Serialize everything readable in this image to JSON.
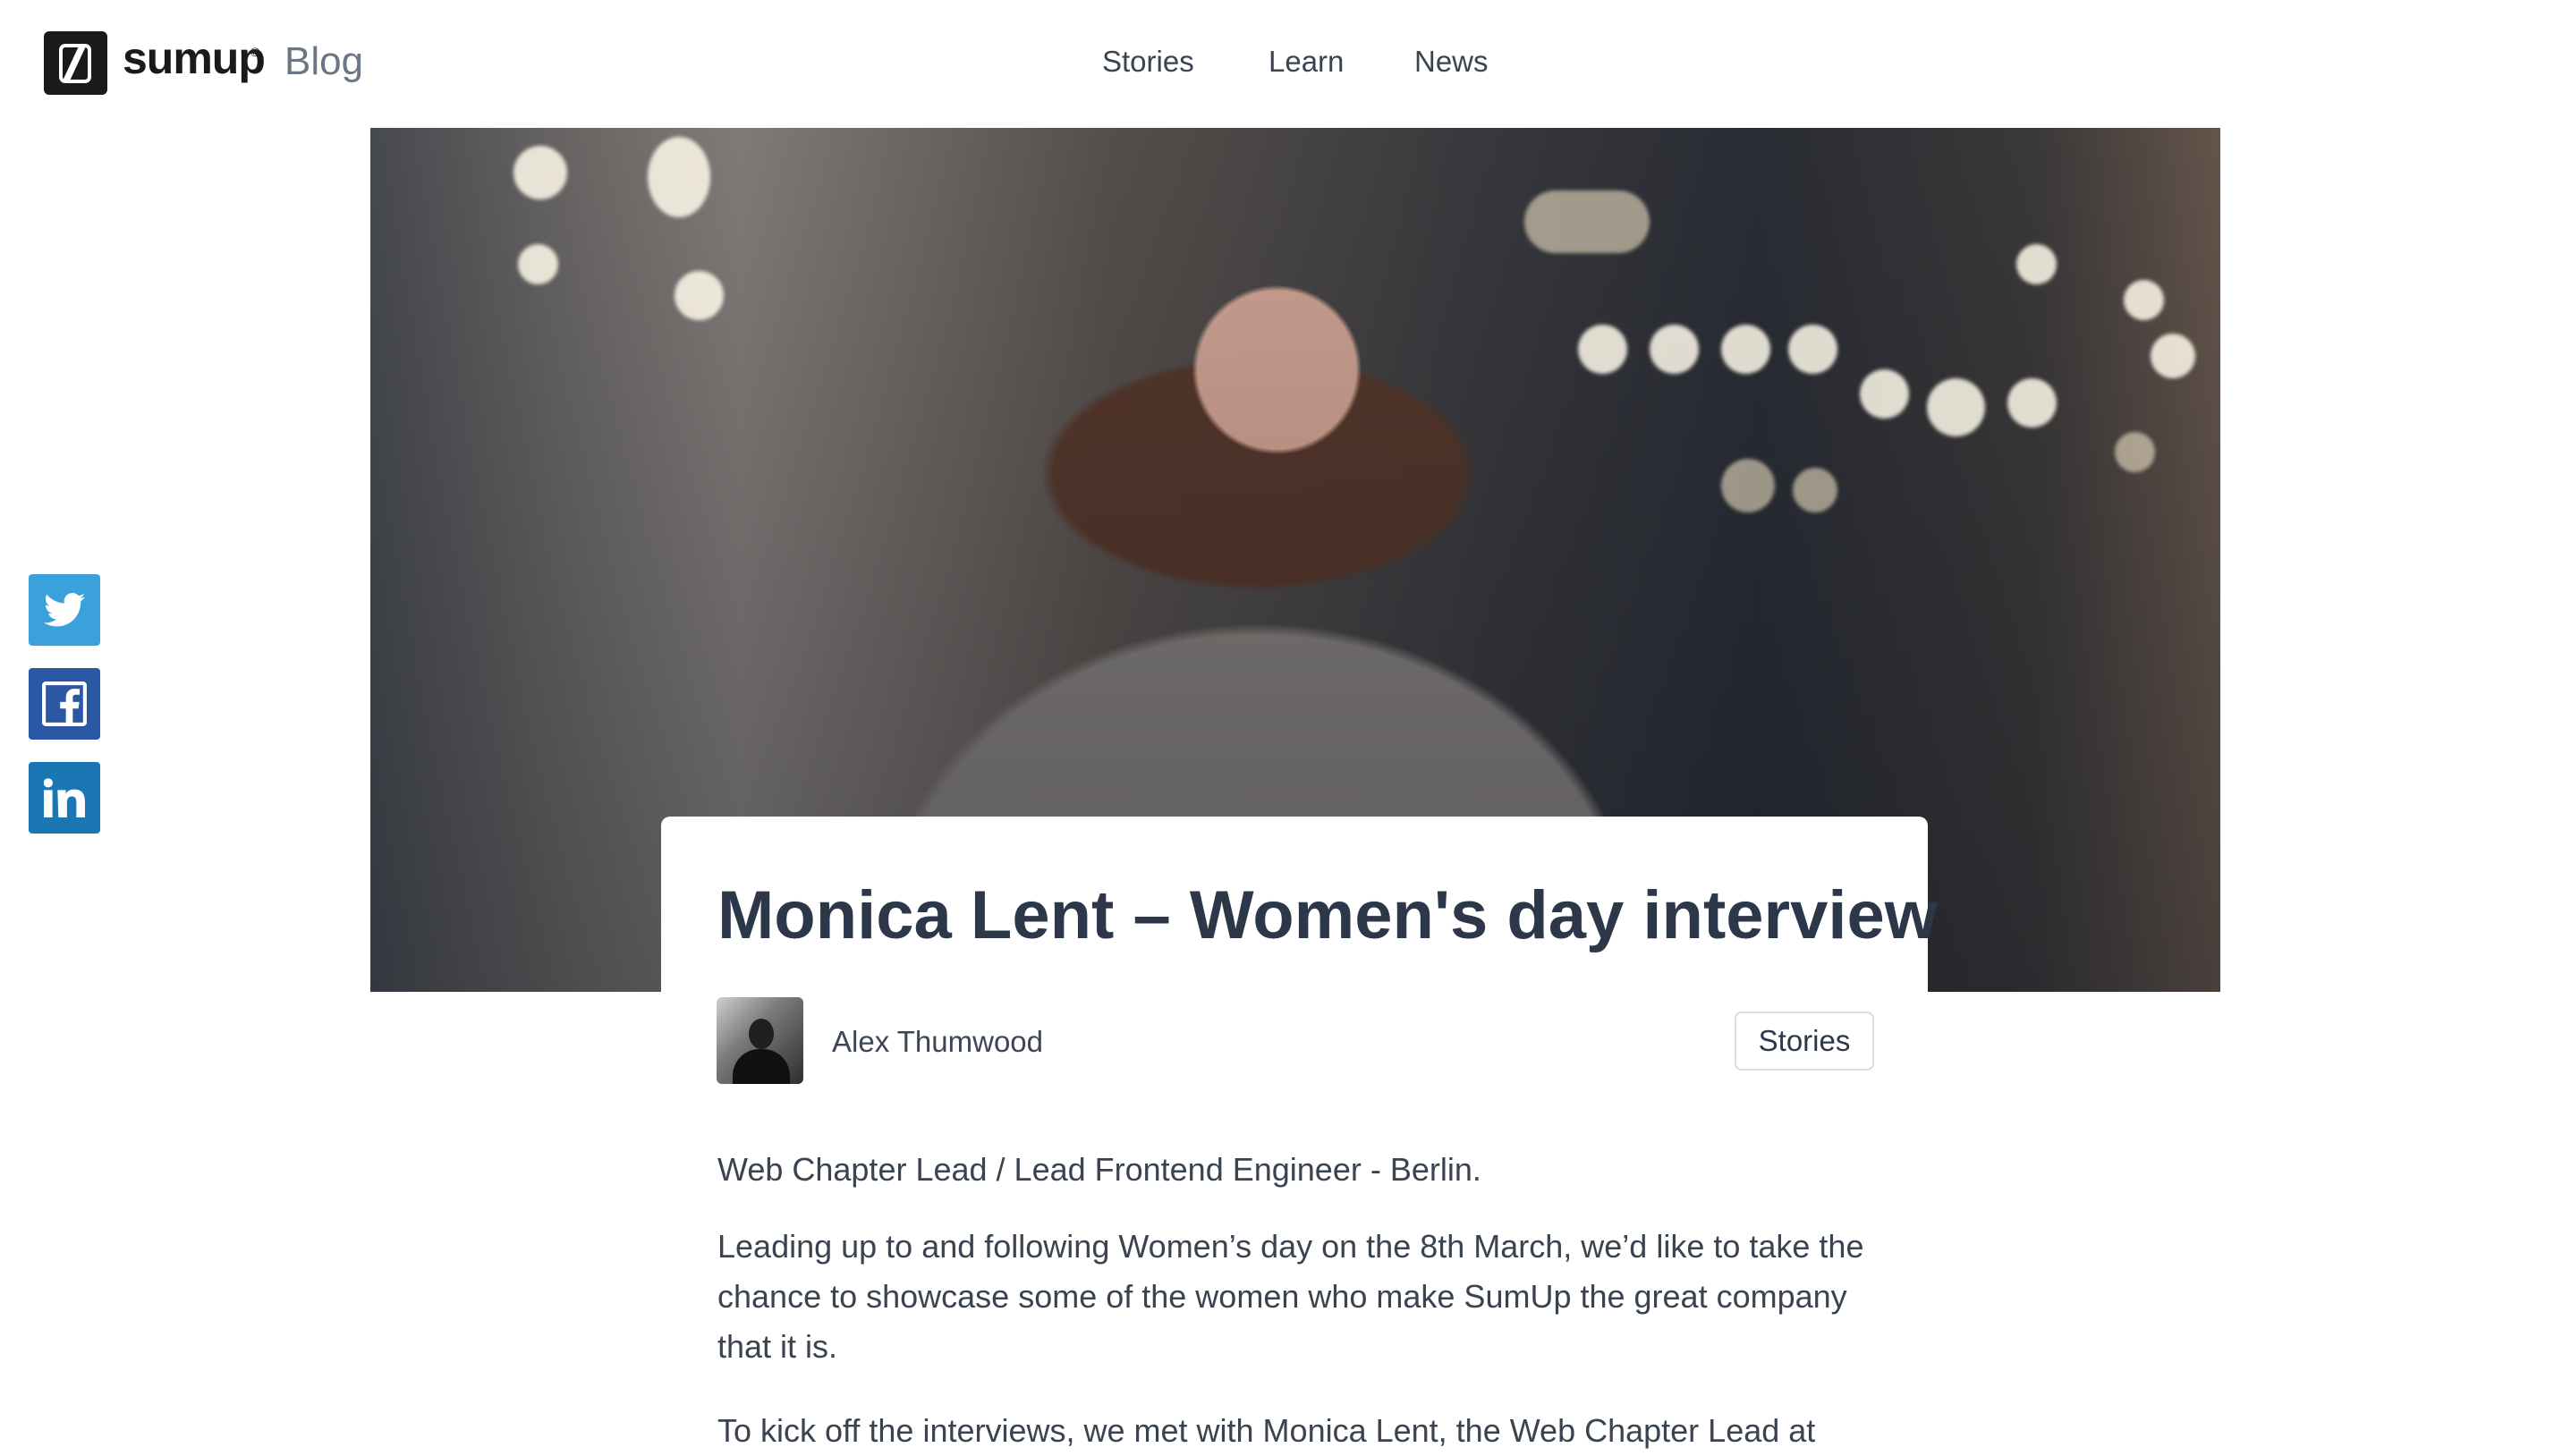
{
  "header": {
    "brand": "sumup",
    "brand_mark": "®",
    "section": "Blog",
    "nav": [
      {
        "label": "Stories"
      },
      {
        "label": "Learn"
      },
      {
        "label": "News"
      }
    ]
  },
  "social": [
    {
      "name": "twitter-icon"
    },
    {
      "name": "facebook-icon"
    },
    {
      "name": "linkedin-icon"
    }
  ],
  "article": {
    "title": "Monica Lent – Women's day interview",
    "author": "Alex Thumwood",
    "category": "Stories",
    "paragraphs": [
      "Web Chapter Lead / Lead Frontend Engineer - Berlin.",
      "Leading up to and following Women’s day on the 8th March, we’d like to take the chance to showcase some of the women who make SumUp the great company that it is.",
      "To kick off the interviews, we met with Monica Lent, the Web Chapter Lead at"
    ]
  },
  "colors": {
    "twitter": "#3aa1dd",
    "facebook": "#2b58a4",
    "linkedin": "#1b77b3",
    "title": "#2c3849"
  }
}
